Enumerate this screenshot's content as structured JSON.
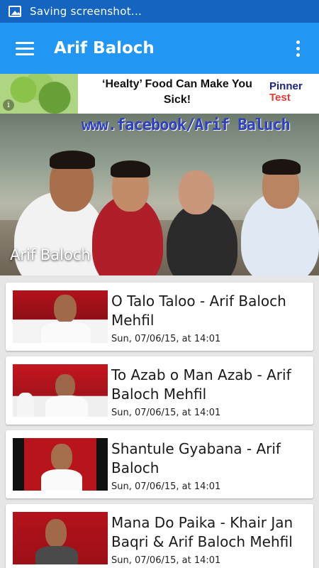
{
  "status_bar": {
    "text": "Saving screenshot...",
    "icon": "image-icon"
  },
  "app_bar": {
    "title": "Arif Baloch",
    "menu_icon": "menu-icon",
    "overflow_icon": "more-vert-icon"
  },
  "ad": {
    "headline": "‘Healty’ Food Can Make You Sick!",
    "brand_line1": "Pinner",
    "brand_line2": "Test",
    "info_icon": "i"
  },
  "hero": {
    "watermark": "www.facebook/Arif Baluch",
    "caption": "Arif Baloch"
  },
  "videos": [
    {
      "title": "O Talo Taloo - Arif Baloch Mehfil",
      "date": "Sun, 07/06/15, at 14:01"
    },
    {
      "title": "To Azab o Man Azab - Arif Baloch Mehfil",
      "date": "Sun, 07/06/15, at 14:01"
    },
    {
      "title": "Shantule Gyabana - Arif Baloch",
      "date": "Sun, 07/06/15, at 14:01"
    },
    {
      "title": "Mana Do Paika - Khair Jan Baqri & Arif Baloch Mehfil",
      "date": "Sun, 07/06/15, at 14:01"
    }
  ],
  "colors": {
    "status_bar": "#1565c0",
    "app_bar": "#2196f3",
    "background": "#e6e6e6"
  }
}
